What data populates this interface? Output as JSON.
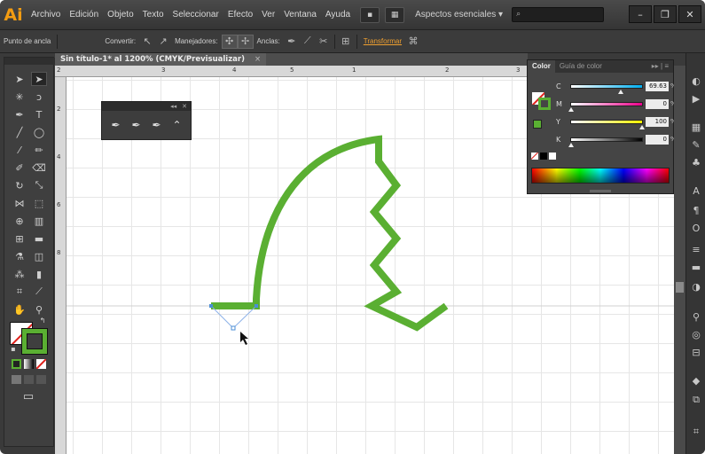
{
  "app": {
    "logo": "Ai",
    "accent": "#f39c12"
  },
  "menu": [
    "Archivo",
    "Edición",
    "Objeto",
    "Texto",
    "Seleccionar",
    "Efecto",
    "Ver",
    "Ventana",
    "Ayuda"
  ],
  "menubar": {
    "workspace": "Aspectos esenciales ▾",
    "search_placeholder": "",
    "window_controls": [
      "–",
      "❐",
      "✕"
    ]
  },
  "controlbar": {
    "label_anchor": "Punto de ancla",
    "label_convert": "Convertir:",
    "label_handles": "Manejadores:",
    "label_anchors": "Anclas:",
    "transform_link": "Transformar"
  },
  "document": {
    "tab_title": "Sin título-1* al 1200% (CMYK/Previsualizar)",
    "tab_close": "×"
  },
  "ruler": {
    "top_numbers": [
      "2",
      "3",
      "4",
      "5",
      "1",
      "2",
      "3"
    ],
    "left_numbers": [
      "2",
      "4",
      "6",
      "8"
    ]
  },
  "color_panel": {
    "tabs": [
      "Color",
      "Guía de color"
    ],
    "menu_glyph": "▸▸ | ≡",
    "channels": [
      {
        "letter": "C",
        "value": "69.63",
        "unit": "%",
        "level": 0.7,
        "gradient": [
          "#ffffff",
          "#00aeef"
        ]
      },
      {
        "letter": "M",
        "value": "0",
        "unit": "%",
        "level": 0.0,
        "gradient": [
          "#ffffff",
          "#ec008c"
        ]
      },
      {
        "letter": "Y",
        "value": "100",
        "unit": "%",
        "level": 1.0,
        "gradient": [
          "#ffffff",
          "#fff200"
        ]
      },
      {
        "letter": "K",
        "value": "0",
        "unit": "%",
        "level": 0.0,
        "gradient": [
          "#ffffff",
          "#000000"
        ]
      }
    ]
  },
  "stroke_color": "#5aaf32",
  "path_color": "#4b8ed6",
  "icons": {
    "toolbox": [
      "selection-icon",
      "direct-selection-icon",
      "magic-wand-icon",
      "lasso-icon",
      "pen-icon",
      "type-icon",
      "line-icon",
      "ellipse-icon",
      "brush-icon",
      "pencil-icon",
      "blob-brush-icon",
      "eraser-icon",
      "rotate-icon",
      "scale-icon",
      "width-icon",
      "free-transform-icon",
      "shape-builder-icon",
      "perspective-icon",
      "mesh-icon",
      "gradient-icon",
      "eyedropper-icon",
      "blend-icon",
      "symbol-sprayer-icon",
      "column-graph-icon",
      "artboard-icon",
      "slice-icon",
      "hand-icon",
      "zoom-icon"
    ],
    "pen_panel": [
      "pen-icon",
      "add-anchor-icon",
      "delete-anchor-icon",
      "convert-anchor-icon"
    ]
  }
}
